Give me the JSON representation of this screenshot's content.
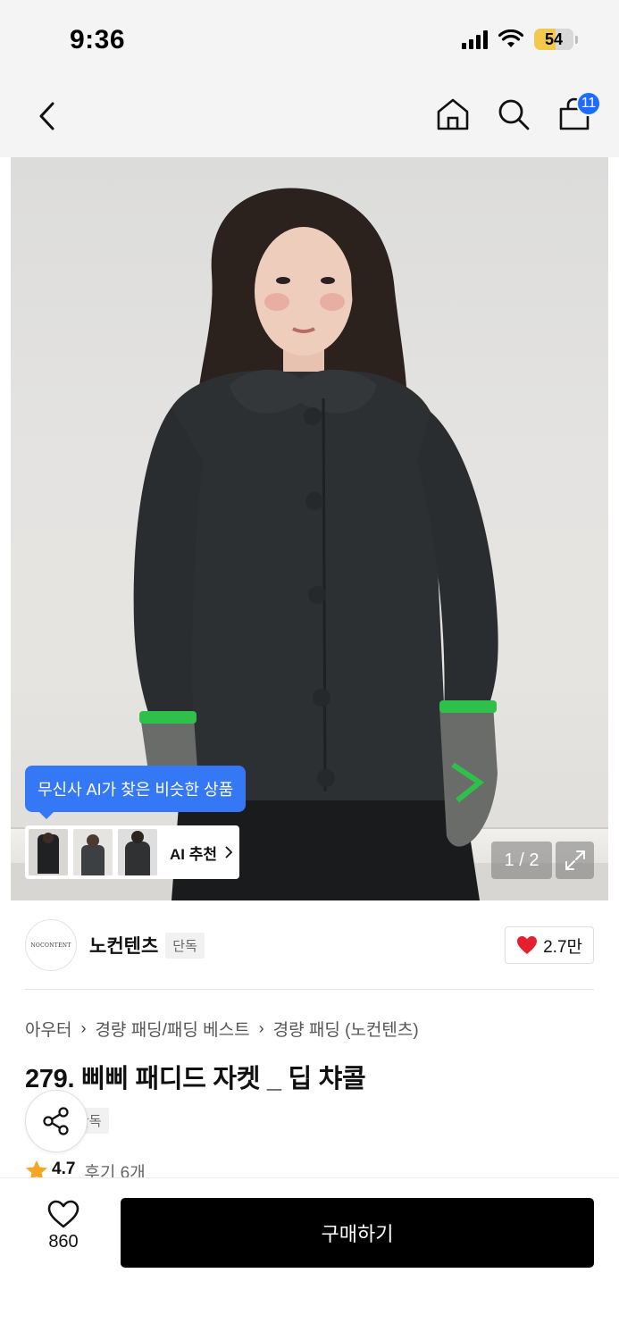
{
  "status_bar": {
    "time": "9:36",
    "battery": "54"
  },
  "nav": {
    "cart_count": "11"
  },
  "hero": {
    "ai_tooltip": "무신사 AI가 찾은 비슷한 상품",
    "ai_label": "AI 추천",
    "page_indicator": "1 / 2"
  },
  "brand": {
    "logo_text": "NOCONTENT",
    "name": "노컨텐츠",
    "badge": "단독",
    "likes": "2.7만"
  },
  "breadcrumb": [
    "아우터",
    "경량 패딩/패딩 베스트",
    "경량 패딩 (노컨텐츠)"
  ],
  "product": {
    "title": "279. 삐삐 패디드 자켓 _ 딥 챠콜",
    "badge": "단독",
    "rating": "4.7",
    "reviews": "후기 6개"
  },
  "bottom": {
    "wish_count": "860",
    "buy_label": "구매하기"
  },
  "colors": {
    "accent_blue": "#3478f6",
    "cart_badge": "#1e6bff",
    "heart_red": "#e5202e",
    "star": "#f5a623",
    "buy_button": "#000000"
  }
}
